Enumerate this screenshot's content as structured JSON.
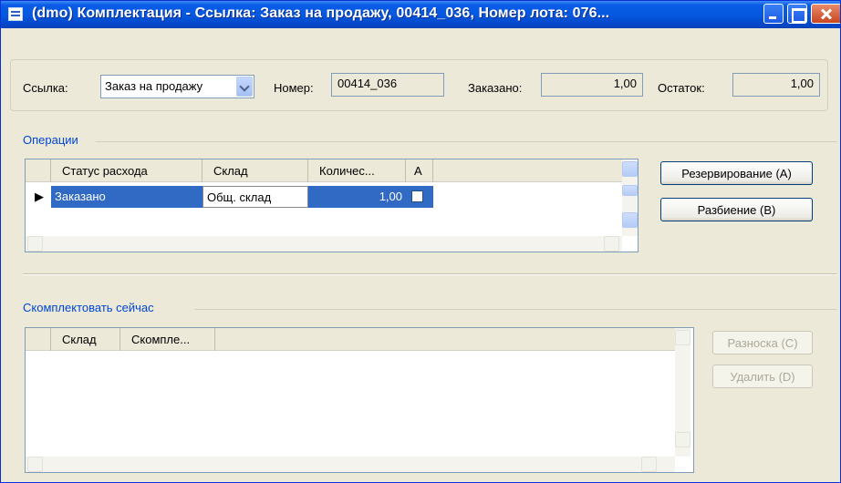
{
  "window": {
    "title": "(dmo) Комплектация - Ссылка: Заказ на продажу, 00414_036, Номер лота: 076..."
  },
  "header": {
    "ref_label": "Ссылка:",
    "ref_value": "Заказ на продажу",
    "number_label": "Номер:",
    "number_value": "00414_036",
    "ordered_label": "Заказано:",
    "ordered_value": "1,00",
    "remainder_label": "Остаток:",
    "remainder_value": "1,00"
  },
  "operations": {
    "title": "Операции",
    "columns": [
      "Статус расхода",
      "Склад",
      "Количес...",
      "А"
    ],
    "rows": [
      {
        "status": "Заказано",
        "warehouse": "Общ. склад",
        "quantity": "1,00",
        "a_checked": false
      }
    ],
    "buttons": {
      "reserve": "Резервирование (A)",
      "split": "Разбиение (B)"
    }
  },
  "pick_now": {
    "title": "Скомплектовать сейчас",
    "columns": [
      "Склад",
      "Скомпле..."
    ],
    "buttons": {
      "post": "Разноска (C)",
      "delete": "Удалить (D)"
    }
  },
  "colors": {
    "titlebar": "#0559e0",
    "section_title": "#0046d5",
    "selection": "#316ac5",
    "window_bg": "#ece9d8"
  }
}
